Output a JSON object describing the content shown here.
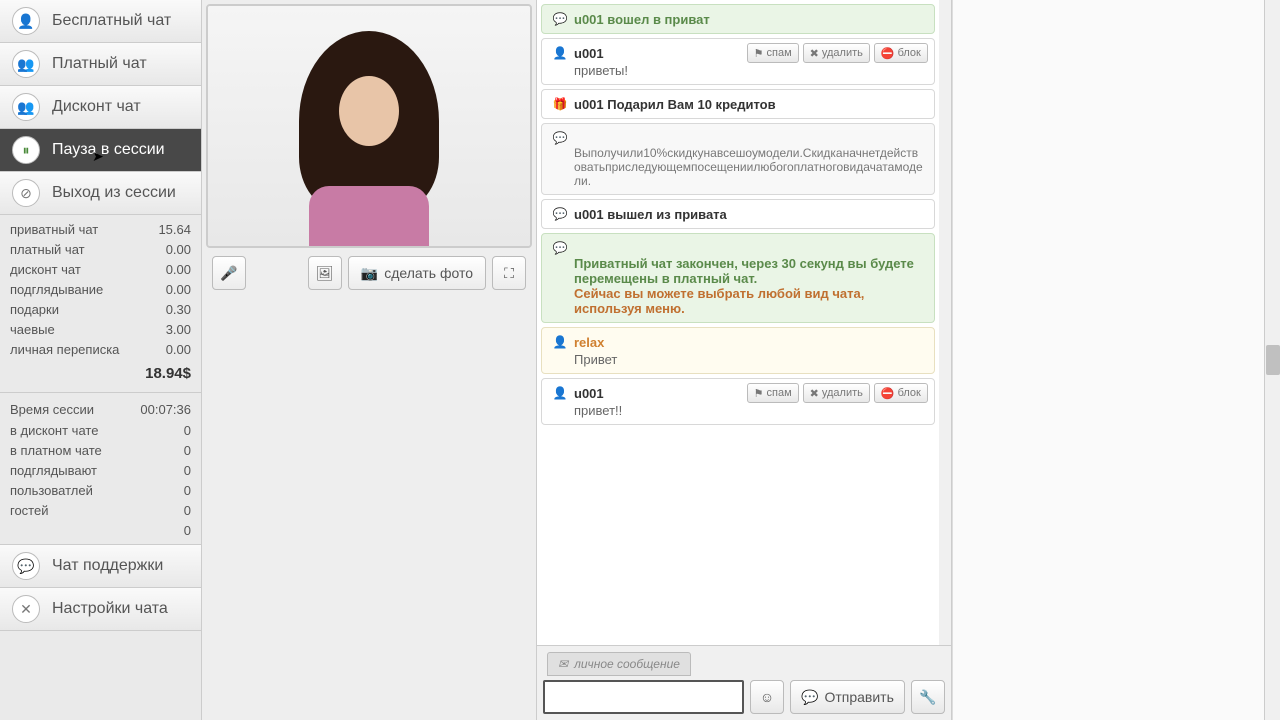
{
  "sidebar": {
    "items": [
      {
        "label": "Бесплатный чат",
        "icon": "👤"
      },
      {
        "label": "Платный чат",
        "icon": "👥"
      },
      {
        "label": "Дисконт чат",
        "icon": "👥"
      },
      {
        "label": "Пауза в сессии",
        "icon": "⏸",
        "active": true
      },
      {
        "label": "Выход из сессии",
        "icon": "⊘"
      }
    ],
    "support": {
      "label": "Чат поддержки",
      "icon": "💬"
    },
    "settings": {
      "label": "Настройки чата",
      "icon": "✕"
    }
  },
  "earnings": {
    "rows": [
      {
        "label": "приватный чат",
        "value": "15.64"
      },
      {
        "label": "платный чат",
        "value": "0.00"
      },
      {
        "label": "дисконт чат",
        "value": "0.00"
      },
      {
        "label": "подглядывание",
        "value": "0.00"
      },
      {
        "label": "подарки",
        "value": "0.30"
      },
      {
        "label": "чаевые",
        "value": "3.00"
      },
      {
        "label": "личная переписка",
        "value": "0.00"
      }
    ],
    "total": "18.94$"
  },
  "session": {
    "timer_label": "Время сессии",
    "timer_value": "00:07:36",
    "rows": [
      {
        "label": "в дисконт чате",
        "value": "0"
      },
      {
        "label": "в платном чате",
        "value": "0"
      },
      {
        "label": "подглядывают",
        "value": "0"
      },
      {
        "label": "пользоватлей",
        "value": "0"
      },
      {
        "label": "гостей",
        "value": "0"
      }
    ],
    "extra": "0"
  },
  "video": {
    "photo_label": "сделать фото"
  },
  "chat": {
    "m0": "u001 вошел в приват",
    "m1_user": "u001",
    "m1_text": "приветы!",
    "m2": "u001 Подарил Вам 10 кредитов",
    "m3": "Выполучили10%скидкунавсешоумодели.Скидканачнетдействоватьприследующемпосещениилюбогоплатноговидачатамодели.",
    "m4": "u001 вышел из привата",
    "m5a": "Приватный чат закончен, через 30 секунд вы будете перемещены в платный чат.",
    "m5b": "Сейчас вы можете выбрать любой вид чата, используя меню.",
    "m6_user": "relax",
    "m6_text": "Привет",
    "m7_user": "u001",
    "m7_text": "привет!!",
    "actions": {
      "spam": "спам",
      "delete": "удалить",
      "block": "блок"
    }
  },
  "input": {
    "pm_label": "личное сообщение",
    "send": "Отправить"
  }
}
